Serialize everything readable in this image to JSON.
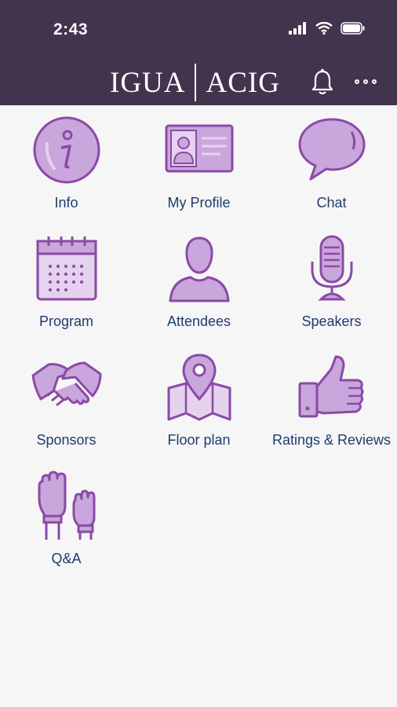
{
  "status_bar": {
    "time": "2:43"
  },
  "header": {
    "logo_left": "IGUA",
    "logo_right": "ACIG"
  },
  "colors": {
    "header_bg": "#43344d",
    "accent": "#8b4aa6",
    "icon_fill": "#c9a6dc",
    "label": "#1f3b6e"
  },
  "menu": [
    {
      "label": "Info",
      "icon": "info-icon"
    },
    {
      "label": "My Profile",
      "icon": "id-card-icon"
    },
    {
      "label": "Chat",
      "icon": "chat-bubble-icon"
    },
    {
      "label": "Program",
      "icon": "calendar-icon"
    },
    {
      "label": "Attendees",
      "icon": "person-icon"
    },
    {
      "label": "Speakers",
      "icon": "microphone-icon"
    },
    {
      "label": "Sponsors",
      "icon": "handshake-icon"
    },
    {
      "label": "Floor plan",
      "icon": "map-pin-icon"
    },
    {
      "label": "Ratings & Reviews",
      "icon": "thumbs-up-icon"
    },
    {
      "label": "Q&A",
      "icon": "raised-hands-icon"
    }
  ]
}
